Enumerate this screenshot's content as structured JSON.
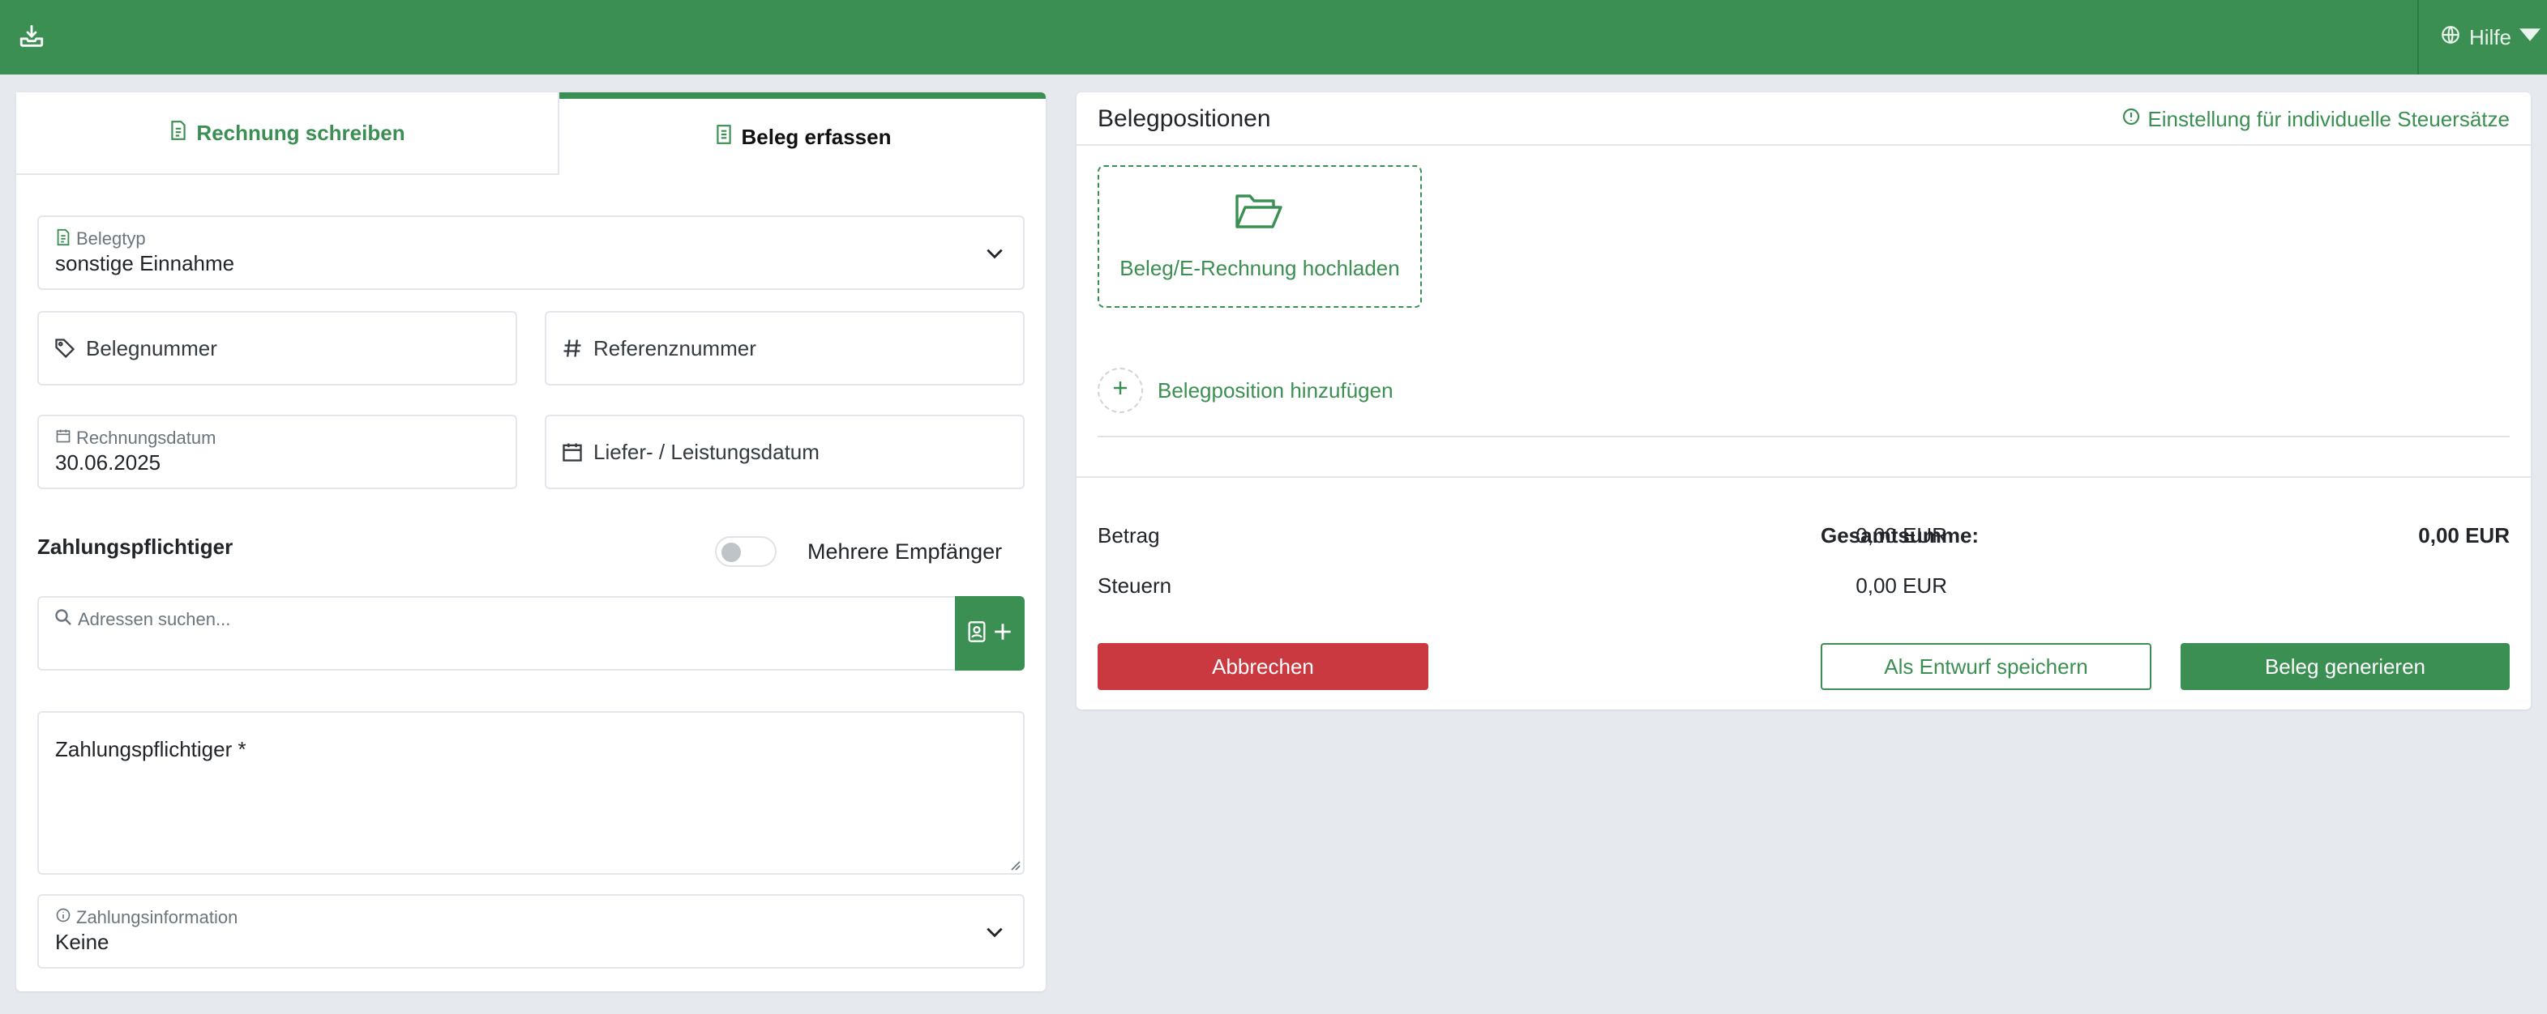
{
  "header": {
    "help_label": "Hilfe"
  },
  "tabs": {
    "invoice": "Rechnung schreiben",
    "receipt": "Beleg erfassen"
  },
  "form": {
    "belegtyp_label": "Belegtyp",
    "belegtyp_value": "sonstige Einnahme",
    "belegnummer_placeholder": "Belegnummer",
    "referenznummer_placeholder": "Referenznummer",
    "rechnungsdatum_label": "Rechnungsdatum",
    "rechnungsdatum_value": "30.06.2025",
    "leistungsdatum_placeholder": "Liefer- / Leistungsdatum",
    "payer_section_title": "Zahlungspflichtiger",
    "multi_recipient_label": "Mehrere Empfänger",
    "multi_recipient_enabled": false,
    "address_search_placeholder": "Adressen suchen...",
    "payer_textarea_label": "Zahlungspflichtiger *",
    "zahlungsinfo_label": "Zahlungsinformation",
    "zahlungsinfo_value": "Keine"
  },
  "positions": {
    "title": "Belegpositionen",
    "settings_link": "Einstellung für individuelle Steuersätze",
    "upload_label": "Beleg/E-Rechnung hochladen",
    "add_position_label": "Belegposition hinzufügen"
  },
  "summary": {
    "betrag_label": "Betrag",
    "betrag_value": "0,00 EUR",
    "steuern_label": "Steuern",
    "steuern_value": "0,00 EUR",
    "gesamt_label": "Gesamtsumme:",
    "gesamt_value": "0,00 EUR"
  },
  "actions": {
    "cancel": "Abbrechen",
    "save_draft": "Als Entwurf speichern",
    "generate": "Beleg generieren"
  },
  "colors": {
    "brand": "#3b8f52",
    "danger": "#c9393f",
    "background": "#e6e9ee"
  }
}
